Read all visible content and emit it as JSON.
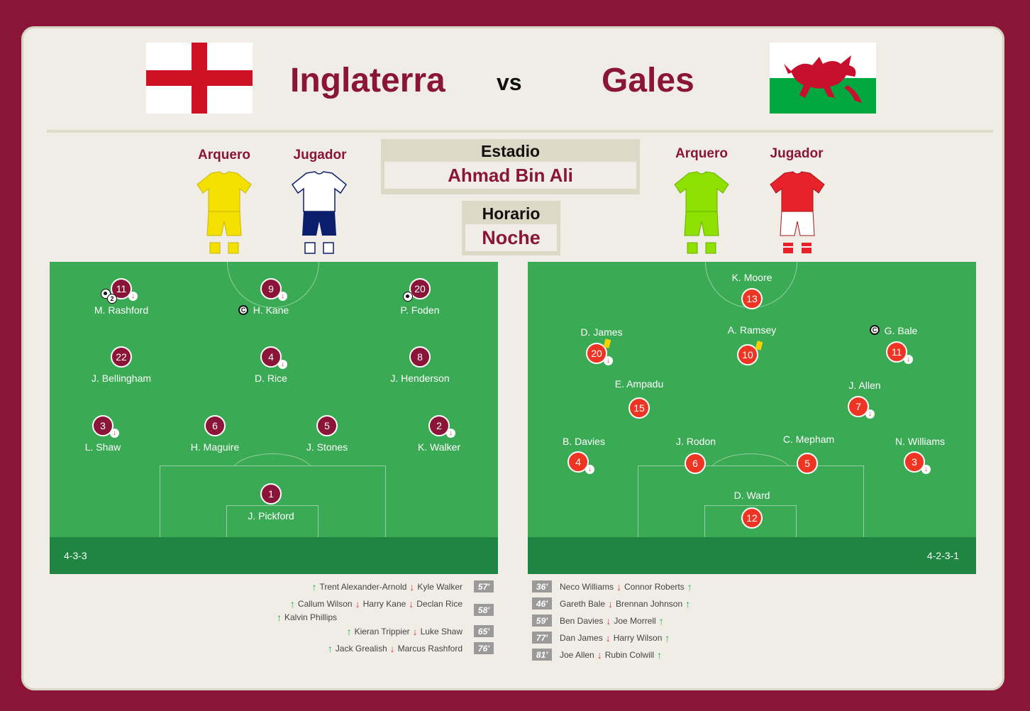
{
  "match": {
    "home": "Inglaterra",
    "away": "Gales",
    "vs": "vs"
  },
  "kits": {
    "gk_label": "Arquero",
    "player_label": "Jugador",
    "home_gk_color": "#f4e000",
    "home_player_color": "#ffffff",
    "home_shorts_color": "#0b1e6e",
    "away_gk_color": "#8ee000",
    "away_player_color": "#e8222a"
  },
  "info": {
    "stadium_label": "Estadio",
    "stadium": "Ahmad Bin Ali",
    "time_label": "Horario",
    "time": "Noche"
  },
  "england": {
    "formation": "4-3-3",
    "players": [
      {
        "num": "11",
        "name": "M. Rashford"
      },
      {
        "num": "9",
        "name": "H. Kane"
      },
      {
        "num": "20",
        "name": "P. Foden"
      },
      {
        "num": "22",
        "name": "J. Bellingham"
      },
      {
        "num": "4",
        "name": "D. Rice"
      },
      {
        "num": "8",
        "name": "J. Henderson"
      },
      {
        "num": "3",
        "name": "L. Shaw"
      },
      {
        "num": "6",
        "name": "H. Maguire"
      },
      {
        "num": "5",
        "name": "J. Stones"
      },
      {
        "num": "2",
        "name": "K. Walker"
      },
      {
        "num": "1",
        "name": "J. Pickford"
      }
    ],
    "rashford_goals": "2",
    "subs": [
      {
        "in": "Trent Alexander-Arnold",
        "out": "Kyle Walker",
        "min": "57'"
      },
      {
        "in": "Callum Wilson",
        "out": "Harry Kane",
        "out2": "Declan Rice",
        "in2": "Kalvin Phillips",
        "min": "58'"
      },
      {
        "in": "Kieran Trippier",
        "out": "Luke Shaw",
        "min": "65'"
      },
      {
        "in": "Jack Grealish",
        "out": "Marcus Rashford",
        "min": "76'"
      }
    ]
  },
  "wales": {
    "formation": "4-2-3-1",
    "players": [
      {
        "num": "13",
        "name": "K. Moore"
      },
      {
        "num": "20",
        "name": "D. James"
      },
      {
        "num": "10",
        "name": "A. Ramsey"
      },
      {
        "num": "11",
        "name": "G. Bale"
      },
      {
        "num": "15",
        "name": "E. Ampadu"
      },
      {
        "num": "7",
        "name": "J. Allen"
      },
      {
        "num": "4",
        "name": "B. Davies"
      },
      {
        "num": "6",
        "name": "J. Rodon"
      },
      {
        "num": "5",
        "name": "C. Mepham"
      },
      {
        "num": "3",
        "name": "N. Williams"
      },
      {
        "num": "12",
        "name": "D. Ward"
      }
    ],
    "subs": [
      {
        "min": "36'",
        "out": "Neco Williams",
        "in": "Connor Roberts"
      },
      {
        "min": "46'",
        "out": "Gareth Bale",
        "in": "Brennan Johnson"
      },
      {
        "min": "59'",
        "out": "Ben Davies",
        "in": "Joe Morrell"
      },
      {
        "min": "77'",
        "out": "Dan James",
        "in": "Harry Wilson"
      },
      {
        "min": "81'",
        "out": "Joe Allen",
        "in": "Rubin Colwill"
      }
    ]
  },
  "icons": {
    "sub_out": "↓",
    "sub_in": "↑",
    "captain": "C"
  }
}
